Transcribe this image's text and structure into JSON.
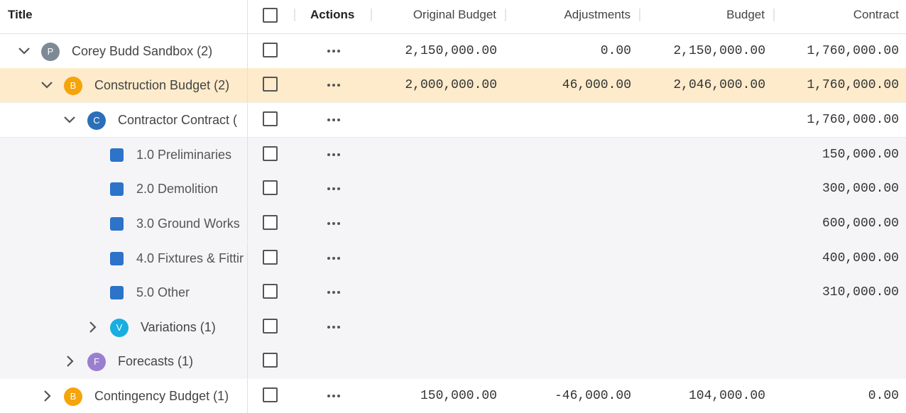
{
  "header": {
    "title": "Title",
    "actions": "Actions",
    "original_budget": "Original Budget",
    "adjustments": "Adjustments",
    "budget": "Budget",
    "contract": "Contract"
  },
  "rows": [
    {
      "label": "Corey Budd Sandbox",
      "count": "(2)",
      "badge": "P",
      "badge_color": "#7d8a96",
      "original_budget": "2,150,000.00",
      "adjustments": "0.00",
      "budget": "2,150,000.00",
      "contract": "1,760,000.00"
    },
    {
      "label": "Construction Budget",
      "count": "(2)",
      "badge": "B",
      "badge_color": "#f5a40a",
      "original_budget": "2,000,000.00",
      "adjustments": "46,000.00",
      "budget": "2,046,000.00",
      "contract": "1,760,000.00"
    },
    {
      "label": "Contractor Contract (",
      "count": "",
      "badge": "C",
      "badge_color": "#2c6fb8",
      "original_budget": "",
      "adjustments": "",
      "budget": "",
      "contract": "1,760,000.00"
    },
    {
      "label": "1.0 Preliminaries",
      "contract": "150,000.00"
    },
    {
      "label": "2.0 Demolition",
      "contract": "300,000.00"
    },
    {
      "label": "3.0 Ground Works",
      "contract": "600,000.00"
    },
    {
      "label": "4.0 Fixtures & Fittir",
      "contract": "400,000.00"
    },
    {
      "label": "5.0 Other",
      "contract": "310,000.00"
    },
    {
      "label": "Variations",
      "count": "(1)",
      "badge": "V",
      "badge_color": "#18aee0"
    },
    {
      "label": "Forecasts",
      "count": "(1)",
      "badge": "F",
      "badge_color": "#9a7fd0"
    },
    {
      "label": "Contingency Budget",
      "count": "(1)",
      "badge": "B",
      "badge_color": "#f5a40a",
      "original_budget": "150,000.00",
      "adjustments": "-46,000.00",
      "budget": "104,000.00",
      "contract": "0.00"
    }
  ],
  "colors": {
    "selected_row": "#fdebcb",
    "child_rows": "#f5f5f8",
    "line_item_square": "#2c73c9"
  },
  "icons": {
    "expand": "chevron-down-icon",
    "collapse": "chevron-right-icon",
    "more": "more-horizontal-icon"
  }
}
